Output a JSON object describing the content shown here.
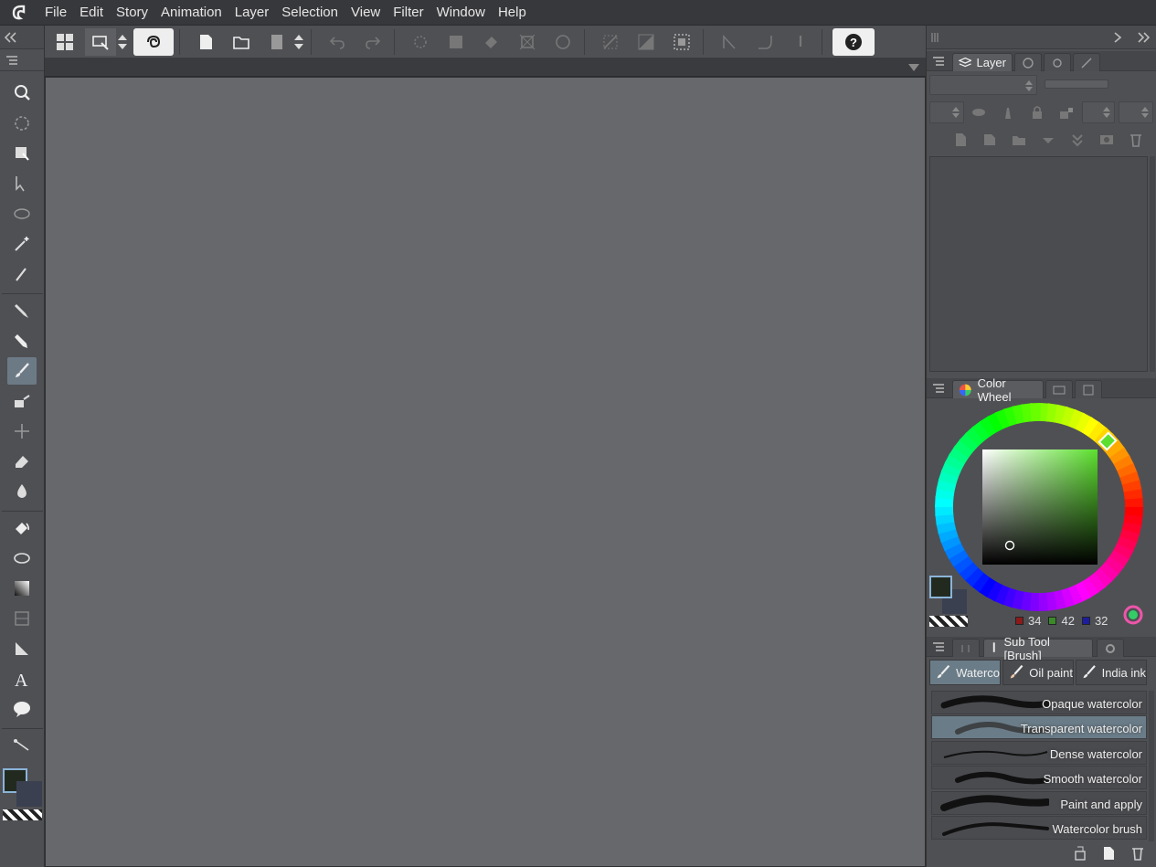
{
  "menu": [
    "File",
    "Edit",
    "Story",
    "Animation",
    "Layer",
    "Selection",
    "View",
    "Filter",
    "Window",
    "Help"
  ],
  "toolbar": {
    "buttons": [
      "grid-icon",
      "easy-screen-icon",
      "sync-icon",
      "new-icon",
      "open-icon",
      "save-icon",
      "undo-icon",
      "redo-icon",
      "clear-icon",
      "fill-selection-icon",
      "transform-icon",
      "deselect-icon",
      "invert-icon",
      "crop-icon",
      "show-selection-icon",
      "ruler-snap-icon",
      "special-ruler-icon",
      "grid-snap-icon",
      "help-icon"
    ]
  },
  "tools": [
    "zoom",
    "rotate",
    "hand",
    "operation",
    "selection",
    "auto-select",
    "eyedropper",
    "pen",
    "pencil",
    "brush",
    "airbrush",
    "decoration",
    "eraser",
    "blend",
    "fill",
    "figure",
    "gradient",
    "frame",
    "ruler",
    "text",
    "balloon",
    "correct-line"
  ],
  "layer_panel": {
    "tab_label": "Layer"
  },
  "color_panel": {
    "tab_label": "Color Wheel",
    "rgb": {
      "r": "34",
      "g": "42",
      "b": "32"
    },
    "colors": {
      "r_swatch": "#8b1a1a",
      "g_swatch": "#3b8a2a",
      "b_swatch": "#1c1c9e",
      "main": "#222a20",
      "sub": "#3a4050"
    }
  },
  "subtool_panel": {
    "title": "Sub Tool [Brush]",
    "groups": [
      "Waterco",
      "Oil paint",
      "India ink"
    ],
    "items": [
      {
        "label": "Opaque watercolor"
      },
      {
        "label": "Transparent watercolor"
      },
      {
        "label": "Dense watercolor"
      },
      {
        "label": "Smooth watercolor"
      },
      {
        "label": "Paint and apply"
      },
      {
        "label": "Watercolor brush"
      }
    ]
  },
  "accent": "#6c7a86"
}
